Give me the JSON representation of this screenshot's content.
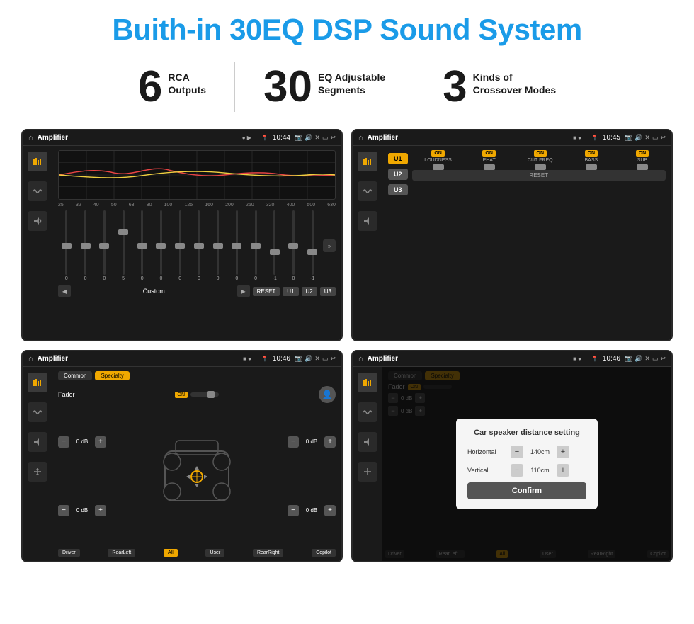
{
  "header": {
    "title": "Buith-in 30EQ DSP Sound System"
  },
  "stats": [
    {
      "number": "6",
      "line1": "RCA",
      "line2": "Outputs"
    },
    {
      "number": "30",
      "line1": "EQ Adjustable",
      "line2": "Segments"
    },
    {
      "number": "3",
      "line1": "Kinds of",
      "line2": "Crossover Modes"
    }
  ],
  "screens": [
    {
      "id": "eq-screen",
      "topbar": {
        "title": "Amplifier",
        "time": "10:44"
      },
      "type": "eq",
      "presets": [
        "Custom",
        "RESET",
        "U1",
        "U2",
        "U3"
      ],
      "frequencies": [
        "25",
        "32",
        "40",
        "50",
        "63",
        "80",
        "100",
        "125",
        "160",
        "200",
        "250",
        "320",
        "400",
        "500",
        "630"
      ],
      "values": [
        "0",
        "0",
        "0",
        "5",
        "0",
        "0",
        "0",
        "0",
        "0",
        "0",
        "0",
        "-1",
        "0",
        "-1"
      ]
    },
    {
      "id": "amp-screen",
      "topbar": {
        "title": "Amplifier",
        "time": "10:45"
      },
      "type": "amp",
      "presets": [
        "U1",
        "U2",
        "U3"
      ],
      "channels": [
        "LOUDNESS",
        "PHAT",
        "CUT FREQ",
        "BASS",
        "SUB"
      ],
      "resetLabel": "RESET"
    },
    {
      "id": "fader-screen",
      "topbar": {
        "title": "Amplifier",
        "time": "10:46"
      },
      "type": "fader",
      "tabs": [
        "Common",
        "Specialty"
      ],
      "activeTab": "Specialty",
      "faderLabel": "Fader",
      "faderOn": "ON",
      "zones": {
        "driver": "Driver",
        "rearLeft": "RearLeft",
        "all": "All",
        "user": "User",
        "rearRight": "RearRight",
        "copilot": "Copilot"
      },
      "volumes": [
        "0 dB",
        "0 dB",
        "0 dB",
        "0 dB"
      ]
    },
    {
      "id": "dialog-screen",
      "topbar": {
        "title": "Amplifier",
        "time": "10:46"
      },
      "type": "dialog",
      "tabs": [
        "Common",
        "Specialty"
      ],
      "dialog": {
        "title": "Car speaker distance setting",
        "fields": [
          {
            "label": "Horizontal",
            "value": "140cm"
          },
          {
            "label": "Vertical",
            "value": "110cm"
          }
        ],
        "confirmLabel": "Confirm"
      },
      "zones": {
        "driver": "Driver",
        "rearLeft": "RearLeft...",
        "user": "User",
        "rearRight": "RearRight",
        "copilot": "Copilot"
      },
      "volumes": [
        "0 dB",
        "0 dB"
      ]
    }
  ]
}
